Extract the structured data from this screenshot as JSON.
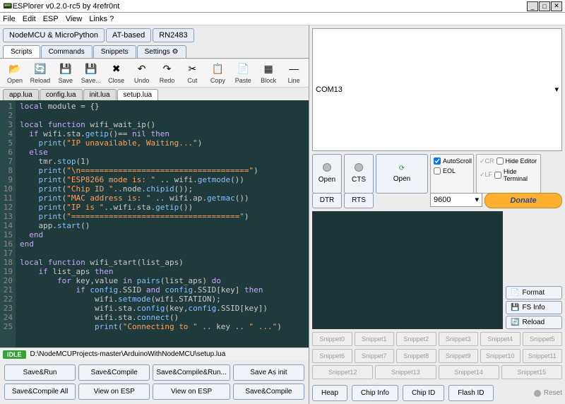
{
  "window": {
    "title": "ESPlorer v0.2.0-rc5 by 4refr0nt"
  },
  "menu": [
    "File",
    "Edit",
    "ESP",
    "View",
    "Links ?"
  ],
  "top_tabs": [
    "NodeMCU & MicroPython",
    "AT-based",
    "RN2483"
  ],
  "sub_tabs": [
    "Scripts",
    "Commands",
    "Snippets",
    "Settings"
  ],
  "toolbar": [
    "Open",
    "Reload",
    "Save",
    "Save...",
    "Close",
    "Undo",
    "Redo",
    "Cut",
    "Copy",
    "Paste",
    "Block",
    "Line"
  ],
  "file_tabs": [
    "app.lua",
    "config.lua",
    "init.lua",
    "setup.lua"
  ],
  "active_file_tab": 3,
  "status": {
    "idle": "IDLE",
    "path": "D:\\NodeMCUProjects-master\\ArduinoWithNodeMCU\\setup.lua"
  },
  "bottom_buttons": [
    "Save&Run",
    "Save&Compile",
    "Save&Compile&Run...",
    "Save As init",
    "Save&Compile All",
    "View on ESP",
    "View on ESP",
    "Save&Compile"
  ],
  "port": {
    "value": "COM13"
  },
  "conn": {
    "open": "Open",
    "cts": "CTS",
    "dtr": "DTR",
    "rts": "RTS",
    "open2": "Open"
  },
  "opts": {
    "autoscroll": "AutoScroll",
    "eol": "EOL",
    "cr": "CR",
    "lf": "LF",
    "hide_editor": "Hide Editor",
    "hide_terminal": "Hide Terminal"
  },
  "baud": "9600",
  "donate": "Donate",
  "side_buttons": [
    {
      "icon": "📄",
      "lbl": "Format"
    },
    {
      "icon": "💾",
      "lbl": "FS Info"
    },
    {
      "icon": "🔄",
      "lbl": "Reload"
    }
  ],
  "snippets": [
    "Snippet0",
    "Snippet1",
    "Snippet2",
    "Snippet3",
    "Snippet4",
    "Snippet5",
    "Snippet6",
    "Snippet7",
    "Snippet8",
    "Snippet9",
    "Snippet10",
    "Snippet11",
    "Snippet12",
    "Snippet13",
    "Snippet14",
    "Snippet15"
  ],
  "foot_buttons": [
    "Heap",
    "Chip Info",
    "Chip ID",
    "Flash ID"
  ],
  "reset": "Reset",
  "code_lines": [
    "local module = {}",
    "",
    "local function wifi_wait_ip()",
    "  if wifi.sta.getip()== nil then",
    "    print(\"IP unavailable, Waiting...\")",
    "  else",
    "    tmr.stop(1)",
    "    print(\"\\n====================================\")",
    "    print(\"ESP8266 mode is: \" .. wifi.getmode())",
    "    print(\"Chip ID \"..node.chipid());",
    "    print(\"MAC address is: \" .. wifi.ap.getmac())",
    "    print(\"IP is \"..wifi.sta.getip())",
    "    print(\"====================================\")",
    "    app.start()",
    "  end",
    "end",
    "",
    "local function wifi_start(list_aps)",
    "    if list_aps then",
    "        for key,value in pairs(list_aps) do",
    "            if config.SSID and config.SSID[key] then",
    "                wifi.setmode(wifi.STATION);",
    "                wifi.sta.config(key,config.SSID[key])",
    "                wifi.sta.connect()",
    "                print(\"Connecting to \" .. key .. \" ...\")"
  ]
}
